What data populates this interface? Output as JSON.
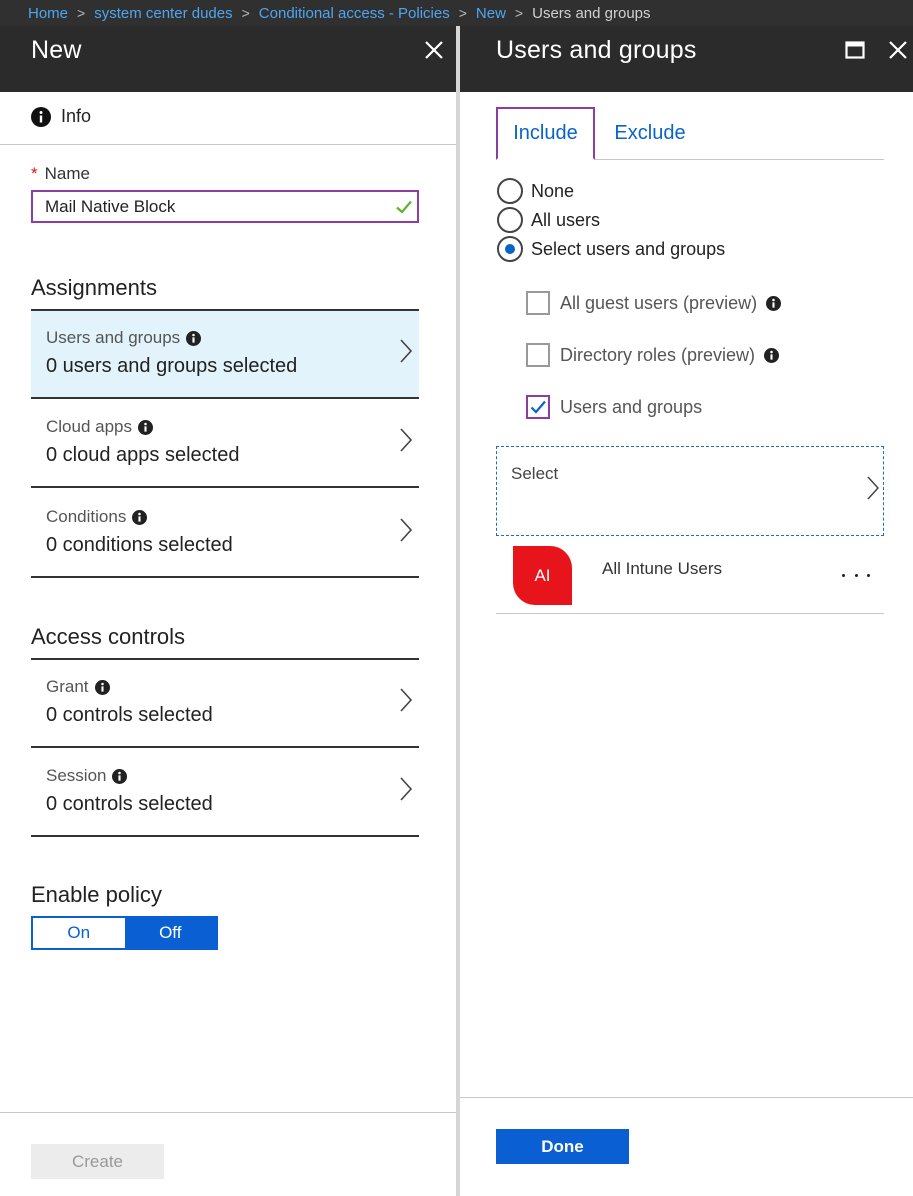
{
  "breadcrumb": {
    "items": [
      "Home",
      "system center dudes",
      "Conditional access - Policies",
      "New",
      "Users and groups"
    ]
  },
  "left_blade": {
    "title": "New",
    "info_label": "Info",
    "name": {
      "label": "Name",
      "required_mark": "*",
      "value": "Mail Native Block"
    },
    "assignments": {
      "title": "Assignments",
      "items": [
        {
          "label": "Users and groups",
          "value": "0 users and groups selected",
          "selected": true
        },
        {
          "label": "Cloud apps",
          "value": "0 cloud apps selected",
          "selected": false
        },
        {
          "label": "Conditions",
          "value": "0 conditions selected",
          "selected": false
        }
      ]
    },
    "access_controls": {
      "title": "Access controls",
      "items": [
        {
          "label": "Grant",
          "value": "0 controls selected"
        },
        {
          "label": "Session",
          "value": "0 controls selected"
        }
      ]
    },
    "enable_policy": {
      "title": "Enable policy",
      "options": [
        "On",
        "Off"
      ],
      "selected": "Off"
    },
    "create_label": "Create"
  },
  "right_blade": {
    "title": "Users and groups",
    "tabs": [
      "Include",
      "Exclude"
    ],
    "active_tab": "Include",
    "radio_options": [
      {
        "label": "None",
        "checked": false
      },
      {
        "label": "All users",
        "checked": false
      },
      {
        "label": "Select users and groups",
        "checked": true
      }
    ],
    "checkbox_options": [
      {
        "label": "All guest users (preview)",
        "checked": false,
        "info": true
      },
      {
        "label": "Directory roles (preview)",
        "checked": false,
        "info": true
      },
      {
        "label": "Users and groups",
        "checked": true,
        "info": false
      }
    ],
    "select_label": "Select",
    "selected_members": [
      {
        "initials": "AI",
        "name": "All Intune Users"
      }
    ],
    "done_label": "Done"
  },
  "colors": {
    "accent_blue": "#0a5fd3",
    "link_blue": "#4ea6f0",
    "focus_purple": "#8b3ca5",
    "selected_bg": "#e2f3fb",
    "header_bg": "#2b2b2b",
    "avatar_red": "#e8141b",
    "valid_green": "#5ab52f"
  }
}
